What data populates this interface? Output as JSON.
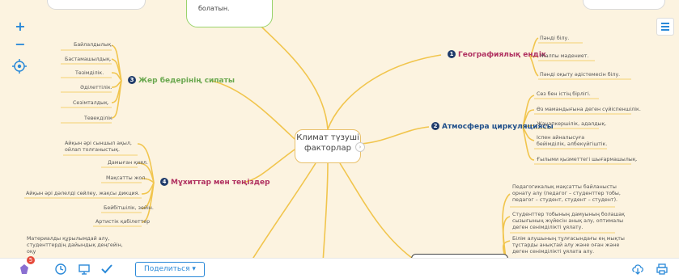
{
  "cloud_text": "болатын.",
  "center_node": {
    "line1": "Климат түзуші",
    "line2": "факторлар"
  },
  "branches": [
    {
      "num": "1",
      "label": "Географиялық ендік",
      "color": "#b03060"
    },
    {
      "num": "2",
      "label": "Атмосфера циркуляциясы",
      "color": "#1f4f8a"
    },
    {
      "num": "3",
      "label": "Жер бедерінің сипаты",
      "color": "#6aa84f"
    },
    {
      "num": "4",
      "label": "Мұхиттар мен теңіздер",
      "color": "#b03060"
    }
  ],
  "geo_leaves": [
    "Пәнді білу.",
    "Жалпы мәдениет.",
    "Пәнді оқыту әдістемесін білу."
  ],
  "atmo_leaves": [
    "Сөз бен істің бірлігі.",
    "Өз мамандығына деген сүйіспеншілік.",
    "Жауапкершілік, адалдық.",
    "Іспен айналысуға бейімділік, әлбекүйгіштік.",
    "Ғылыми қызметтегі шығармашылық."
  ],
  "relief_leaves": [
    "Байлалдылық.",
    "Бастамашылдық.",
    "Төзімділік.",
    "Әділеттілік.",
    "Сезімталдық.",
    "Тевекділік"
  ],
  "ocean_leaves": [
    "Айқын әрі сыншыл ақыл, ойлап толғаныстық.",
    "Дамыған қиял.",
    "Мақсатты жол.",
    "Айқын әрі дәлелді сөйлеу, жақсы дикция.",
    "Бейбітшілік, зейін.",
    "Артистік қабілеттер"
  ],
  "lower_right_leaves": [
    "Педагогикалық мақсатты байланысты орнату алу (педагог – студенттер тобы, педагог – студент, студент – студент).",
    "Студенттер тобының дамуының болашақ сызығының жүйесін анық алу, оптималы деген сенімділікті ұялату.",
    "Білім алушының тұлғасындағы ең мықты тұстарды анықтай алу және оған және деген сенімділікті ұялата алу."
  ],
  "lower_left_leaf": "Материалды құрылымдай алу, студенттердің дайындық деңгейін, оқу",
  "bottom": {
    "badge": "5",
    "share_label": "Поделиться ▾"
  },
  "zoom": {
    "plus": "+",
    "minus": "−"
  }
}
